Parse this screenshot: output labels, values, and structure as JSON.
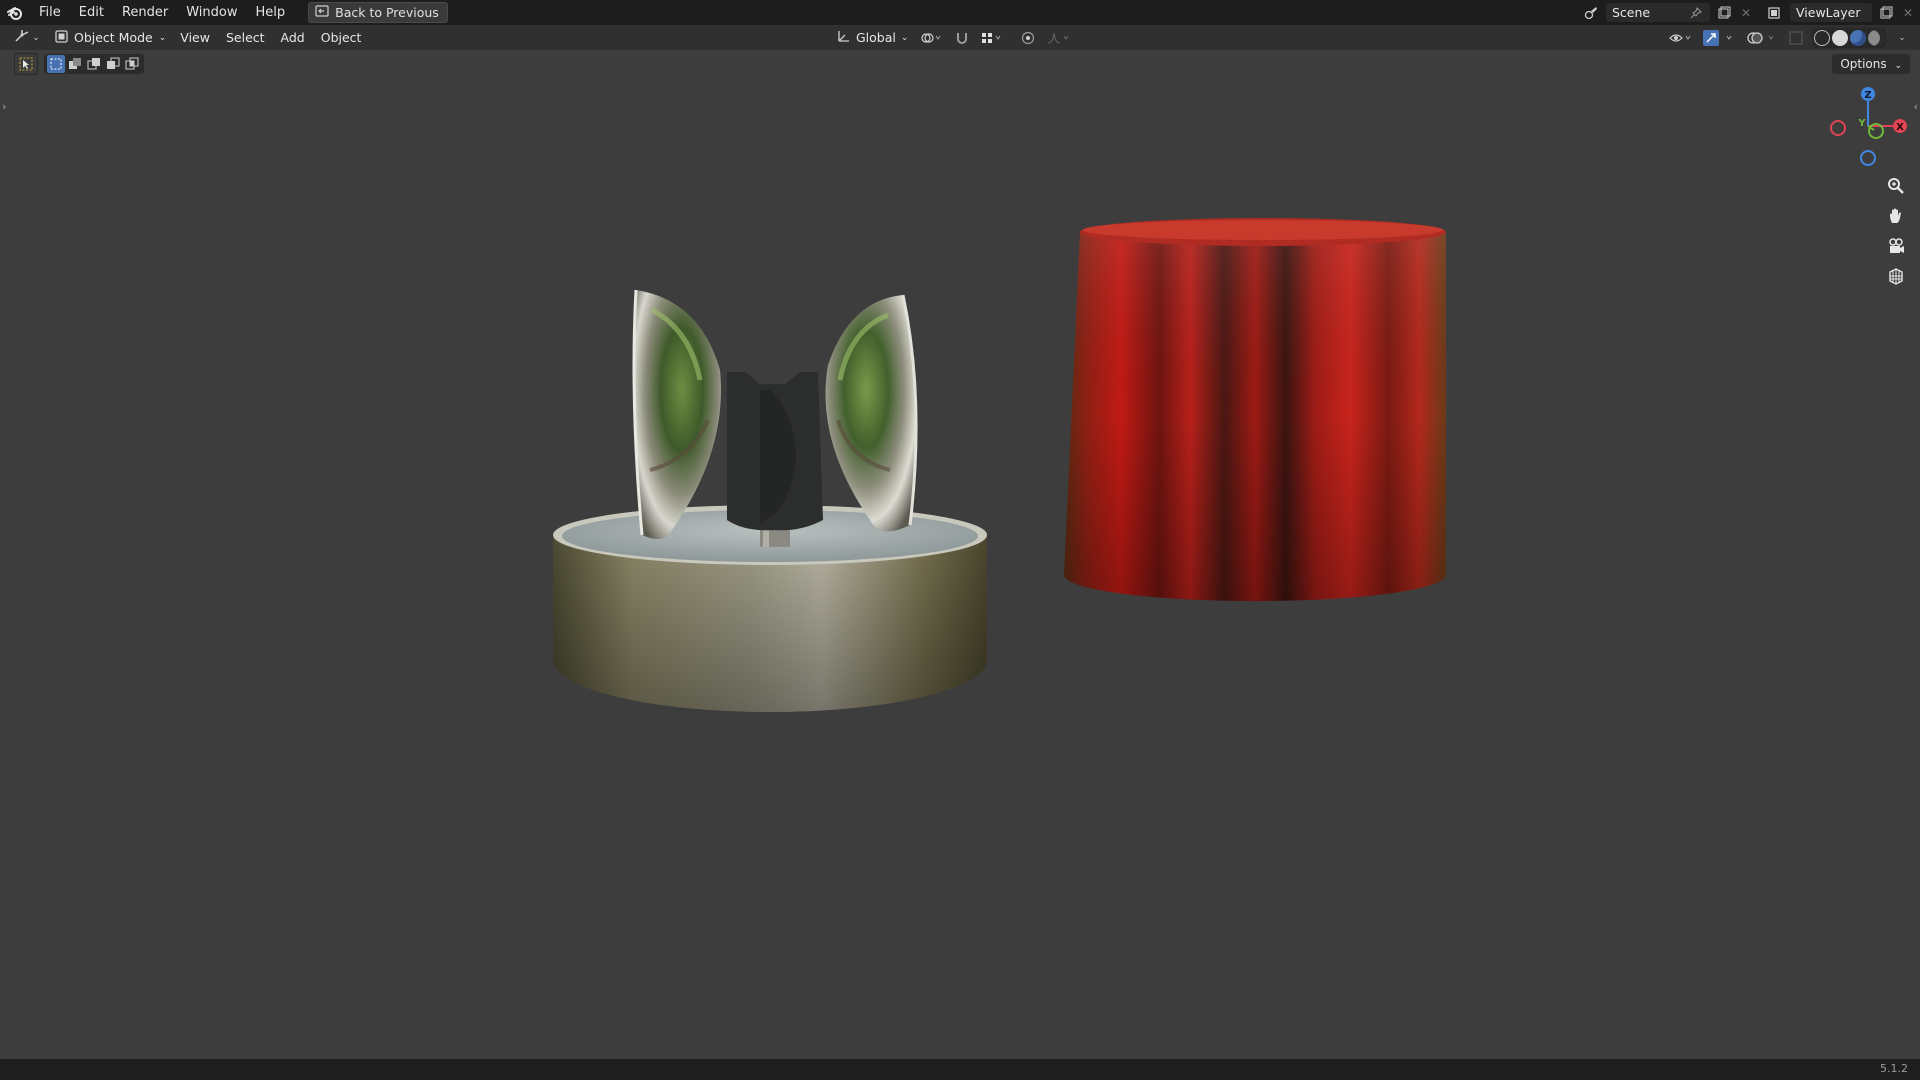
{
  "topbar": {
    "menus": [
      "File",
      "Edit",
      "Render",
      "Window",
      "Help"
    ],
    "back_button": "Back to Previous",
    "scene_name": "Scene",
    "view_layer": "ViewLayer"
  },
  "viewport_header": {
    "mode": "Object Mode",
    "menus": [
      "View",
      "Select",
      "Add",
      "Object"
    ],
    "transform_orientation": "Global"
  },
  "options_label": "Options",
  "gizmo": {
    "z": "Z",
    "y": "Y",
    "x": "X"
  },
  "status": {
    "version": "5.1.2"
  },
  "icons": {
    "logo": "blender-logo-icon",
    "zoom": "zoom-icon",
    "pan": "hand-pan-icon",
    "camera": "camera-view-icon",
    "grid": "ortho-grid-icon"
  },
  "colors": {
    "axis_x": "#e04455",
    "axis_y": "#6fb83a",
    "axis_z": "#3f86e0",
    "viewport_bg": "#3d3d3d",
    "accent": "#4772b3"
  }
}
